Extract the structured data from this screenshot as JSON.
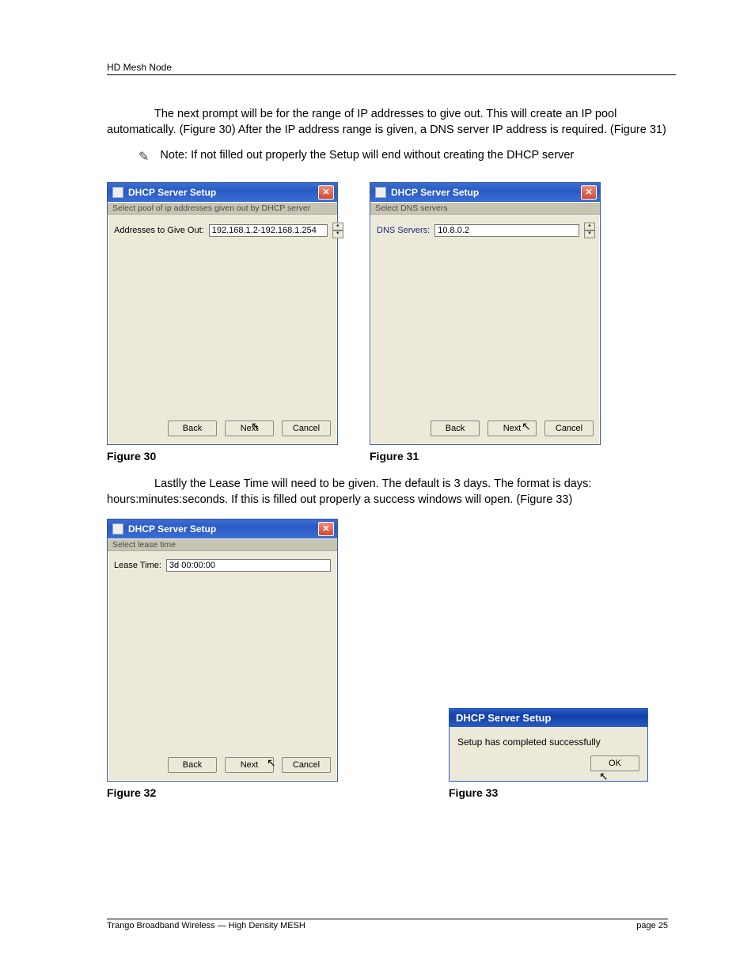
{
  "header": {
    "title": "HD Mesh Node"
  },
  "para1": "The next prompt will be for the range of IP addresses to give out. This will create an IP pool automatically. (Figure 30) After the IP address range is given, a DNS server IP address is required. (Figure 31)",
  "note": {
    "icon": "✎",
    "text": "Note: If not filled out properly the Setup will end without creating the DHCP server"
  },
  "dlg30": {
    "title": "DHCP Server Setup",
    "subtitle": "Select pool of ip addresses given out by DHCP server",
    "field_label": "Addresses to Give Out:",
    "field_value": "192.168.1.2-192.168.1.254",
    "back": "Back",
    "next": "Next",
    "cancel": "Cancel",
    "caption": "Figure 30"
  },
  "dlg31": {
    "title": "DHCP Server Setup",
    "subtitle": "Select DNS servers",
    "field_label": "DNS Servers:",
    "field_value": "10.8.0.2",
    "back": "Back",
    "next": "Next",
    "cancel": "Cancel",
    "caption": "Figure 31"
  },
  "para2": "Lastlly the Lease Time will need to be given. The default is 3 days. The format is days: hours:minutes:seconds. If this is filled out properly a success windows will open. (Figure 33)",
  "dlg32": {
    "title": "DHCP Server Setup",
    "subtitle": "Select lease time",
    "field_label": "Lease Time:",
    "field_value": "3d 00:00:00",
    "back": "Back",
    "next": "Next",
    "cancel": "Cancel",
    "caption": "Figure 32"
  },
  "dlg33": {
    "title": "DHCP Server Setup",
    "message": "Setup has completed successfully",
    "ok": "OK",
    "caption": "Figure 33"
  },
  "footer": {
    "left": "Trango Broadband Wireless — High Density MESH",
    "right": "page 25"
  }
}
